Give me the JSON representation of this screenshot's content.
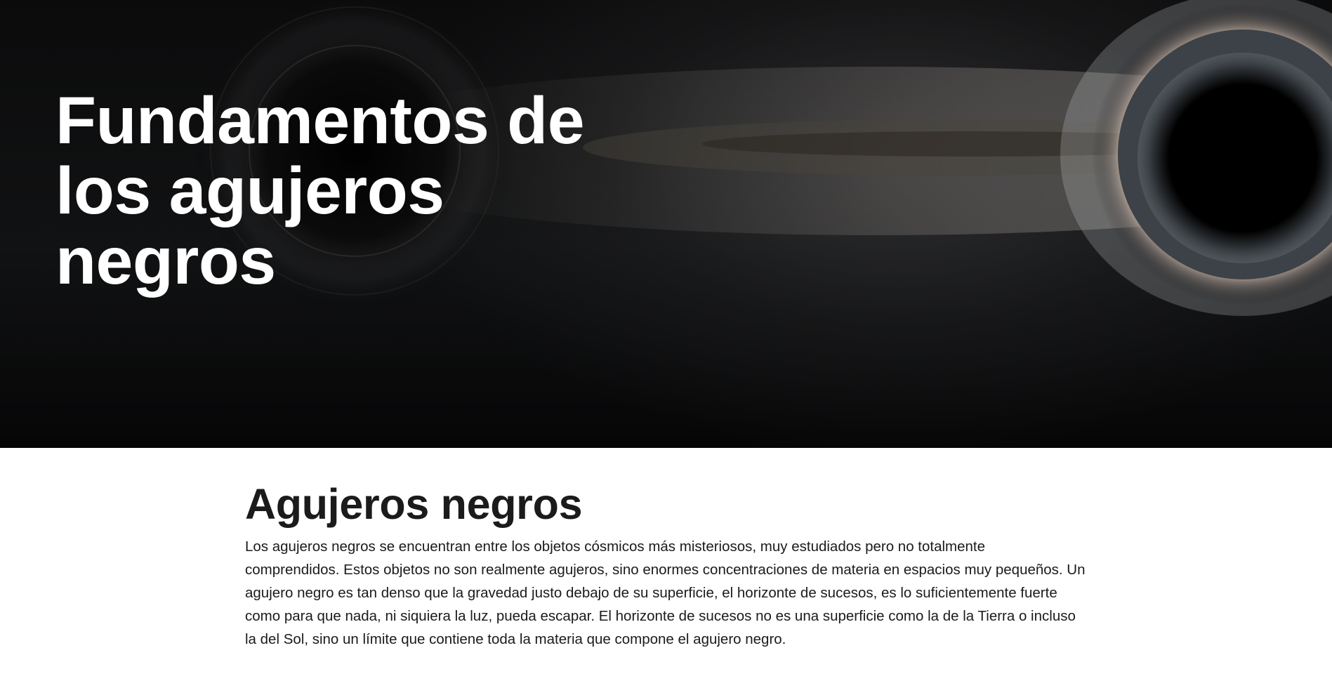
{
  "hero": {
    "title_lines": [
      "Fundamentos de",
      "los agujeros",
      "negros"
    ],
    "image_alt_icon": "black-hole-image"
  },
  "article": {
    "heading": "Agujeros negros",
    "paragraph_lines": [
      "Los agujeros negros se encuentran entre los objetos cósmicos más misteriosos, muy estudiados pero no totalmente",
      "comprendidos. Estos objetos no son realmente agujeros, sino enormes concentraciones de materia en espacios muy pequeños. Un",
      "agujero negro es tan denso que la gravedad justo debajo de su superficie, el horizonte de sucesos, es lo suficientemente fuerte",
      "como para que nada, ni siquiera la luz, pueda escapar. El horizonte de sucesos no es una superficie como la de la Tierra o incluso",
      "la del Sol, sino un límite que contiene toda la materia que compone el agujero negro."
    ]
  },
  "colors": {
    "text": "#1b1b1b",
    "hero_bg": "#0b0b0c",
    "hero_text": "#ffffff"
  }
}
